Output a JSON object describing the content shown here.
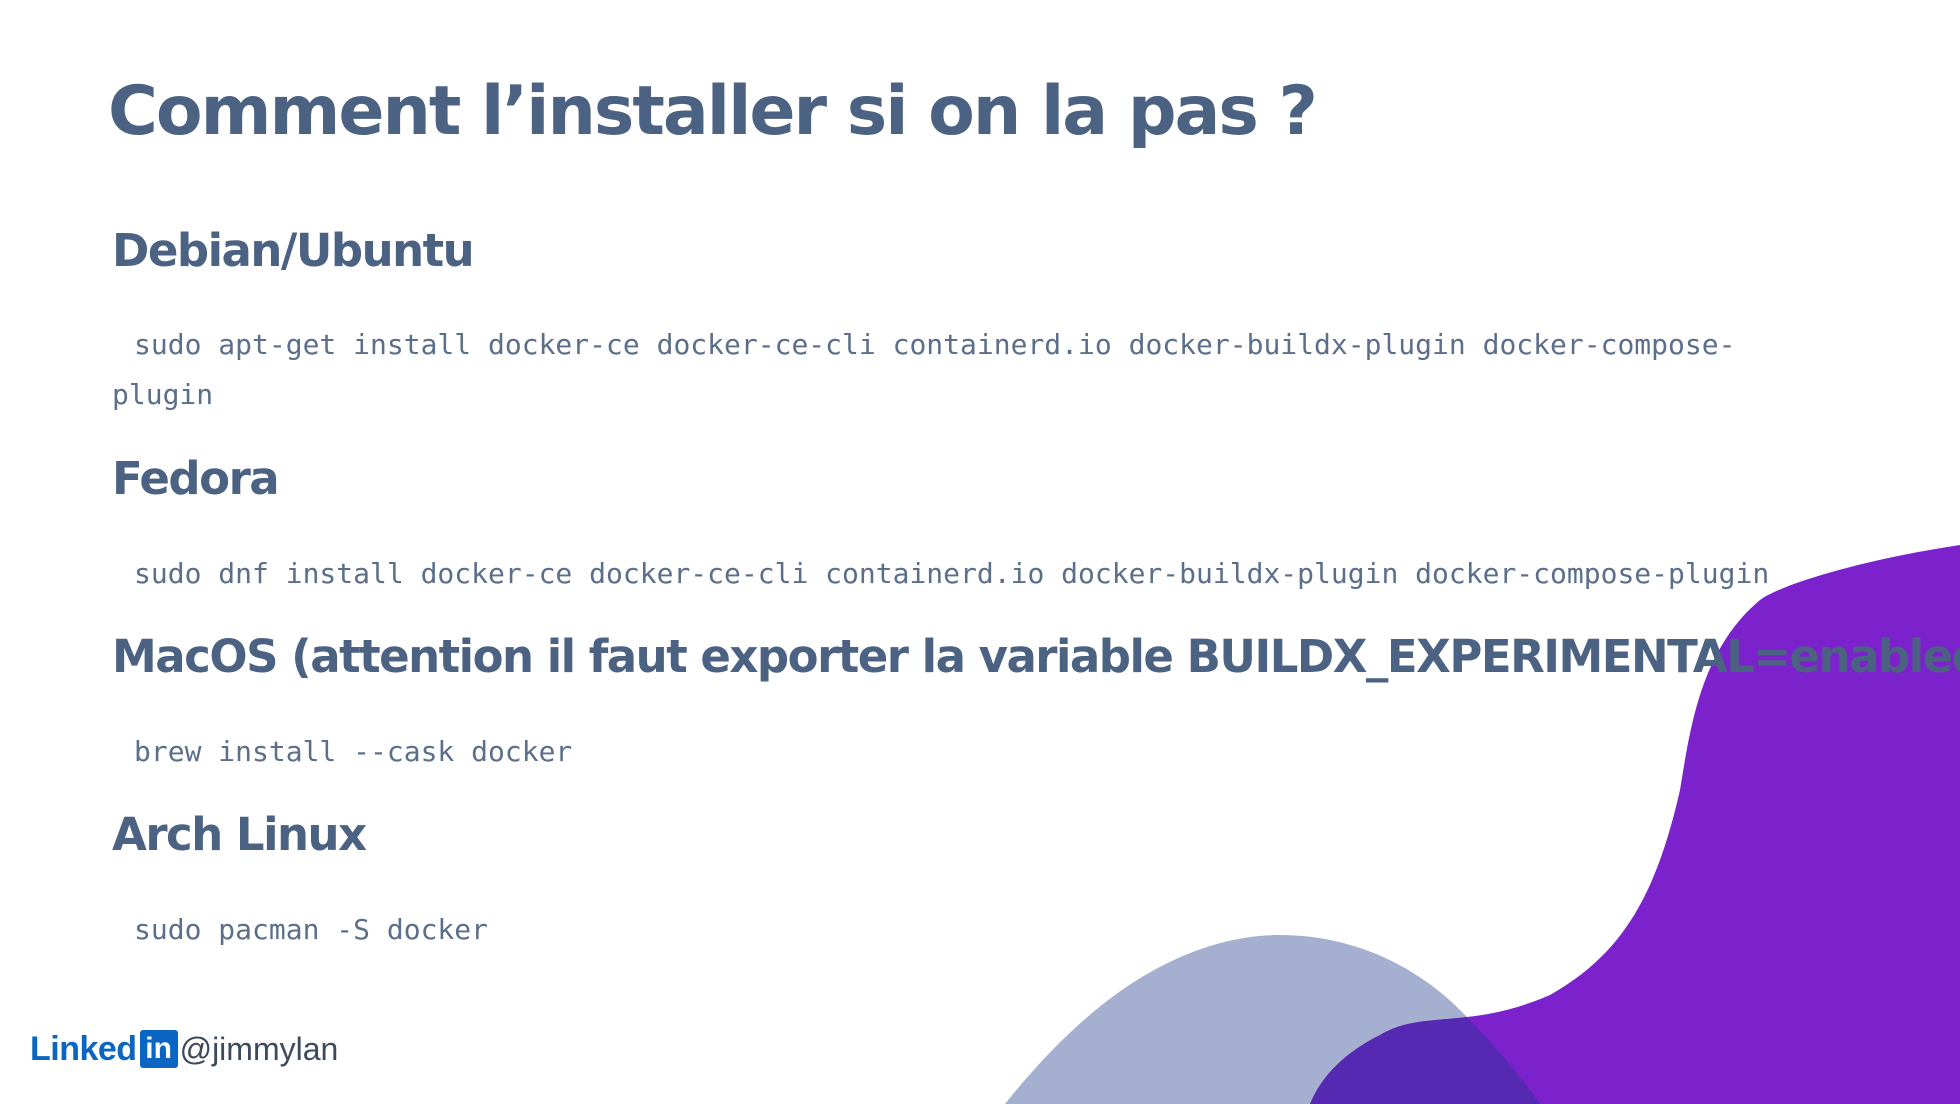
{
  "slide": {
    "title": "Comment l’installer si on la pas ?"
  },
  "sections": [
    {
      "heading": "Debian/Ubuntu",
      "command": "sudo apt-get install docker-ce docker-ce-cli containerd.io docker-buildx-plugin docker-compose-plugin"
    },
    {
      "heading": "Fedora",
      "command": "sudo dnf install docker-ce docker-ce-cli containerd.io docker-buildx-plugin docker-compose-plugin"
    },
    {
      "heading": "MacOS (attention il faut exporter la variable BUILDX_EXPERIMENTAL=enabled)",
      "command": "brew install --cask docker"
    },
    {
      "heading": "Arch Linux",
      "command": "sudo pacman -S docker"
    }
  ],
  "footer": {
    "brand_text": "Linked",
    "brand_box": "in",
    "handle": "@jimmylan"
  },
  "colors": {
    "text": "#4b6282",
    "purple": "#7b22cc",
    "lavender": "#a5b0d0",
    "overlap": "#5629b2",
    "linkedin": "#0a66c2"
  },
  "icons": {
    "logo": "linkedin-logo-icon"
  }
}
